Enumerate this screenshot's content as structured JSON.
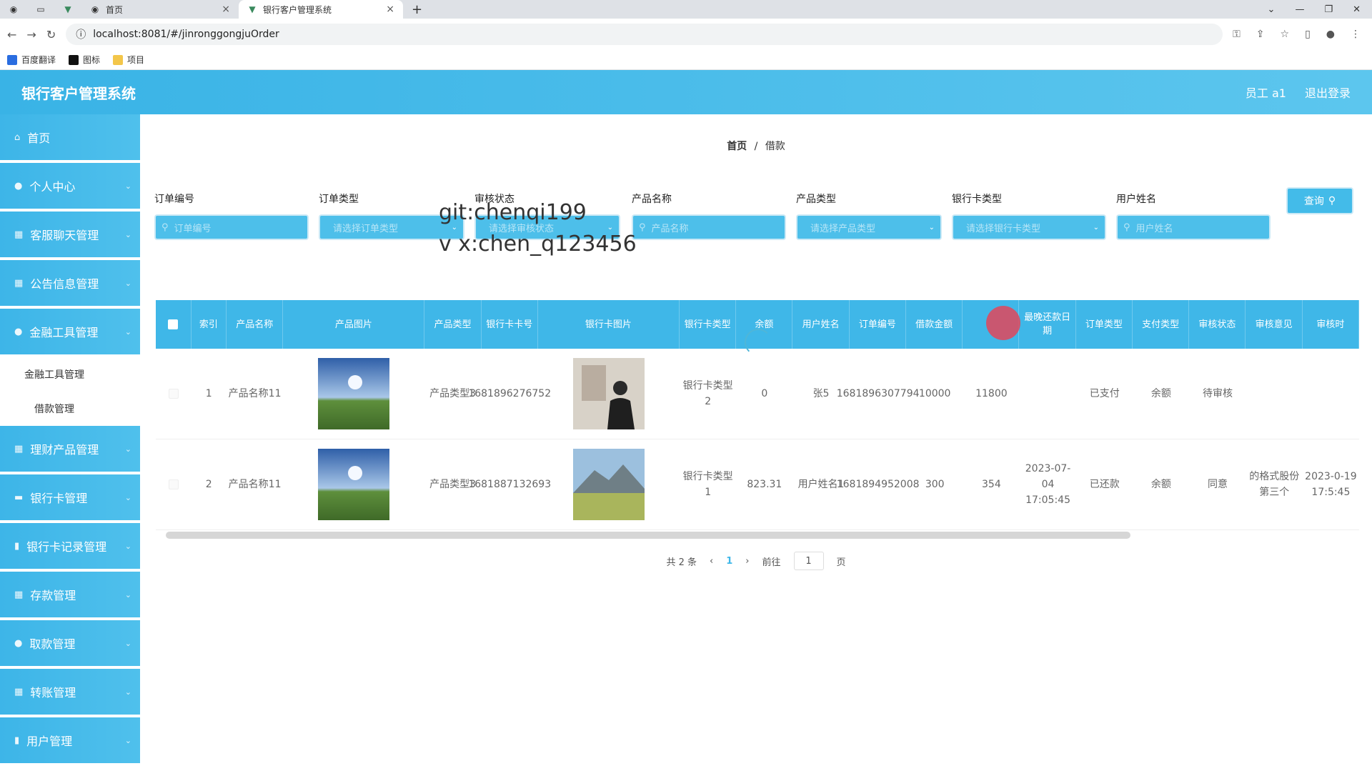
{
  "browser": {
    "tabs": [
      {
        "label": "首页"
      },
      {
        "label": "银行客户管理系统"
      }
    ],
    "url": "localhost:8081/#/jinronggongjuOrder",
    "bookmarks": [
      "百度翻译",
      "图标",
      "项目"
    ]
  },
  "app": {
    "title": "银行客户管理系统",
    "user": "员工 a1",
    "logout": "退出登录"
  },
  "sidebar": {
    "items": [
      {
        "label": "首页",
        "icon": "home-icon"
      },
      {
        "label": "个人中心",
        "icon": "user-icon"
      },
      {
        "label": "客服聊天管理",
        "icon": "grid-icon"
      },
      {
        "label": "公告信息管理",
        "icon": "grid-icon"
      },
      {
        "label": "金融工具管理",
        "icon": "user-icon"
      },
      {
        "label": "理财产品管理",
        "icon": "grid-icon"
      },
      {
        "label": "银行卡管理",
        "icon": "card-icon"
      },
      {
        "label": "银行卡记录管理",
        "icon": "doc-icon"
      },
      {
        "label": "存款管理",
        "icon": "grid-icon"
      },
      {
        "label": "取款管理",
        "icon": "user-icon"
      },
      {
        "label": "转账管理",
        "icon": "grid-icon"
      },
      {
        "label": "用户管理",
        "icon": "doc-icon"
      }
    ],
    "submenu": [
      "金融工具管理",
      "借款管理"
    ]
  },
  "breadcrumb": {
    "home": "首页",
    "sep": "/",
    "current": "借款"
  },
  "filters": [
    {
      "label": "订单编号",
      "placeholder": "订单编号",
      "type": "search"
    },
    {
      "label": "订单类型",
      "placeholder": "请选择订单类型",
      "type": "select"
    },
    {
      "label": "审核状态",
      "placeholder": "请选择审核状态",
      "type": "select"
    },
    {
      "label": "产品名称",
      "placeholder": "产品名称",
      "type": "search"
    },
    {
      "label": "产品类型",
      "placeholder": "请选择产品类型",
      "type": "select"
    },
    {
      "label": "银行卡类型",
      "placeholder": "请选择银行卡类型",
      "type": "select"
    },
    {
      "label": "用户姓名",
      "placeholder": "用户姓名",
      "type": "search"
    }
  ],
  "query_button": "查询",
  "watermark": {
    "line1": "git:chenqi199",
    "line2": "v x:chen_q123456"
  },
  "table": {
    "columns": [
      "索引",
      "产品名称",
      "产品图片",
      "产品类型",
      "银行卡卡号",
      "银行卡图片",
      "银行卡类型",
      "余额",
      "用户姓名",
      "订单编号",
      "借款金额",
      "",
      "最晚还款日期",
      "订单类型",
      "支付类型",
      "审核状态",
      "审核意见",
      "审核时"
    ],
    "rows": [
      {
        "index": "1",
        "product": "产品名称11",
        "ptype": "产品类型3",
        "card": "1681896276752",
        "ctype": "银行卡类型2",
        "balance": "0",
        "user": "张5",
        "order": "1681896307794",
        "amount": "10000",
        "repay": "11800",
        "deadline": "",
        "otype": "已支付",
        "pay": "余额",
        "status": "待审核",
        "opinion": "",
        "time": ""
      },
      {
        "index": "2",
        "product": "产品名称11",
        "ptype": "产品类型3",
        "card": "1681887132693",
        "ctype": "银行卡类型1",
        "balance": "823.31",
        "user": "用户姓名1",
        "order": "1681894952008",
        "amount": "300",
        "repay": "354",
        "deadline": "2023-07-04 17:05:45",
        "otype": "已还款",
        "pay": "余额",
        "status": "同意",
        "opinion": "的格式股份第三个",
        "time": "2023-0-19 17:5:45"
      }
    ]
  },
  "pager": {
    "total": "共 2 条",
    "page": "1",
    "goto": "前往",
    "goto_value": "1",
    "unit": "页"
  }
}
